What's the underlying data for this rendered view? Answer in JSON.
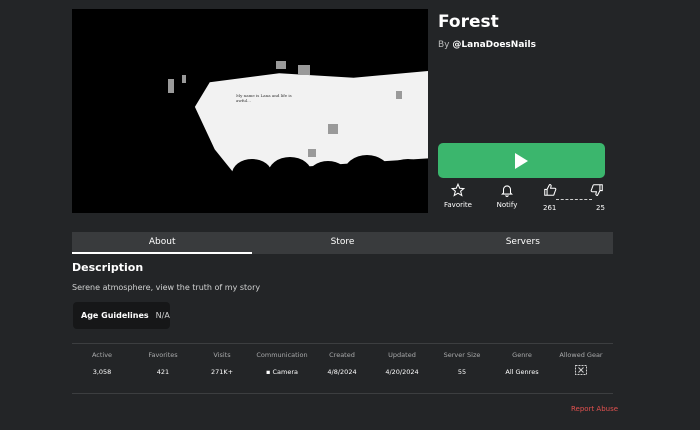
{
  "game": {
    "title": "Forest",
    "by_prefix": "By",
    "creator": "@LanaDoesNails",
    "thumbnail_text": "My name is Lana and life is awful..."
  },
  "actions": {
    "play_icon": "play-icon",
    "favorite_label": "Favorite",
    "notify_label": "Notify",
    "likes": "261",
    "dislikes": "25"
  },
  "tabs": [
    {
      "label": "About",
      "active": true
    },
    {
      "label": "Store",
      "active": false
    },
    {
      "label": "Servers",
      "active": false
    }
  ],
  "about": {
    "description_heading": "Description",
    "description": "Serene atmosphere, view the truth of my story",
    "age_label": "Age Guidelines",
    "age_value": "N/A"
  },
  "stats": [
    {
      "key": "Active",
      "value": "3,058"
    },
    {
      "key": "Favorites",
      "value": "421"
    },
    {
      "key": "Visits",
      "value": "271K+"
    },
    {
      "key": "Communication",
      "value": "Camera"
    },
    {
      "key": "Created",
      "value": "4/8/2024"
    },
    {
      "key": "Updated",
      "value": "4/20/2024"
    },
    {
      "key": "Server Size",
      "value": "55"
    },
    {
      "key": "Genre",
      "value": "All Genres"
    },
    {
      "key": "Allowed Gear",
      "value": ""
    }
  ],
  "footer": {
    "report_label": "Report Abuse"
  },
  "colors": {
    "background": "#232527",
    "play_button": "#3bb66d",
    "report_link": "#e1514f"
  }
}
